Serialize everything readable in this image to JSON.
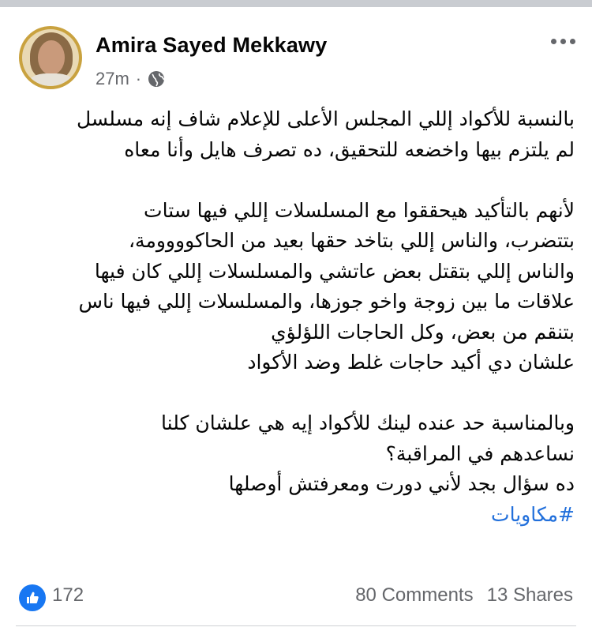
{
  "post": {
    "author": "Amira Sayed Mekkawy",
    "time": "27m",
    "separator": "·",
    "privacy_icon": "globe-icon",
    "more_icon": "more-horizontal-icon",
    "lines": [
      "بالنسبة للأكواد إللي المجلس الأعلى للإعلام شاف إنه مسلسل",
      "لم يلتزم بيها واخضعه للتحقيق، ده تصرف هايل وأنا معاه",
      "",
      " لأنهم بالتأكيد هيحققوا مع المسلسلات إللي فيها ستات",
      "بتتضرب، والناس إللي بتاخد حقها بعيد من الحاكوووومة،",
      "والناس إللي بتقتل بعض عاتشي والمسلسلات إللي كان فيها",
      "علاقات ما بين زوجة واخو جوزها، والمسلسلات إللي فيها ناس",
      "بتنقم من بعض، وكل الحاجات اللؤلؤي",
      "علشان دي أكيد حاجات غلط وضد الأكواد",
      "",
      "وبالمناسبة حد عنده لينك للأكواد إيه هي علشان كلنا",
      "نساعدهم في المراقبة؟",
      "ده سؤال بجد لأني دورت ومعرفتش أوصلها"
    ],
    "hashtag": "#مكاويات"
  },
  "footer": {
    "like_icon": "thumbs-up-icon",
    "like_color": "#1877f2",
    "likes": "172",
    "comments": "80 Comments",
    "shares": "13 Shares"
  }
}
